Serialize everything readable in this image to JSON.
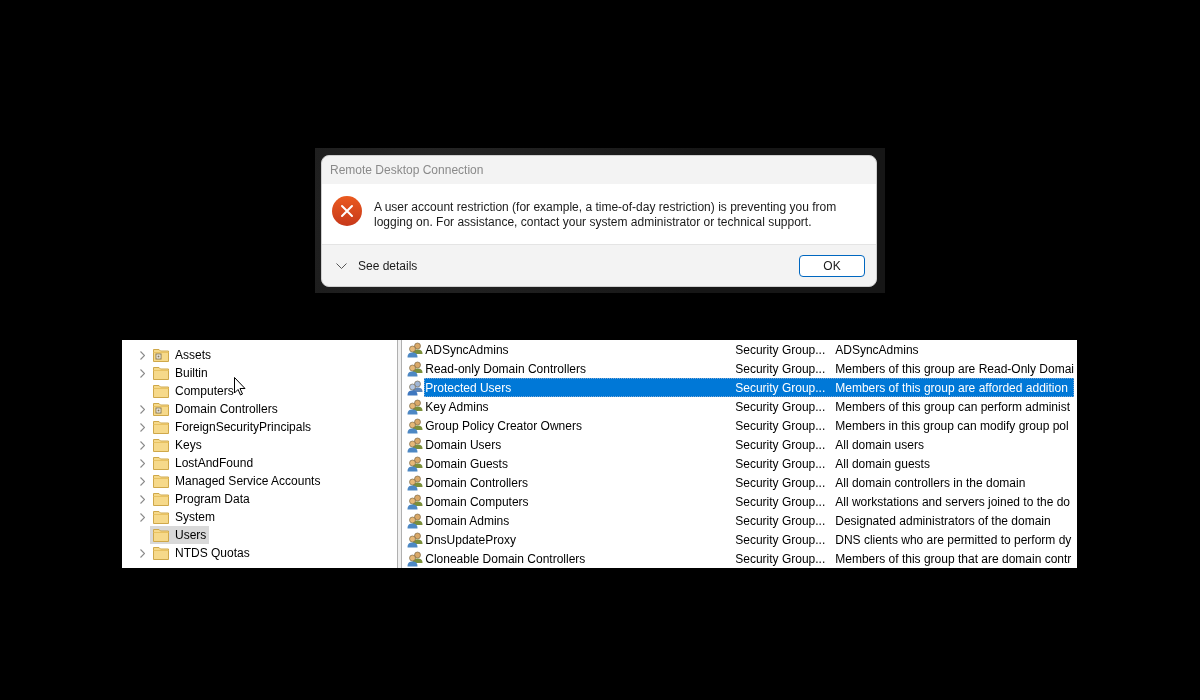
{
  "dialog": {
    "title": "Remote Desktop Connection",
    "message": "A user account restriction (for example, a time-of-day restriction) is preventing you from logging on. For assistance, contact your system administrator or technical support.",
    "details_label": "See details",
    "button": "OK"
  },
  "tree": {
    "items": [
      {
        "label": "Assets",
        "kind": "ou",
        "expandable": true,
        "selected": false
      },
      {
        "label": "Builtin",
        "kind": "folder",
        "expandable": true,
        "selected": false
      },
      {
        "label": "Computers",
        "kind": "folder",
        "expandable": false,
        "selected": false
      },
      {
        "label": "Domain Controllers",
        "kind": "ou",
        "expandable": true,
        "selected": false
      },
      {
        "label": "ForeignSecurityPrincipals",
        "kind": "folder",
        "expandable": true,
        "selected": false
      },
      {
        "label": "Keys",
        "kind": "folder",
        "expandable": true,
        "selected": false
      },
      {
        "label": "LostAndFound",
        "kind": "folder",
        "expandable": true,
        "selected": false
      },
      {
        "label": "Managed Service Accounts",
        "kind": "folder",
        "expandable": true,
        "selected": false
      },
      {
        "label": "Program Data",
        "kind": "folder",
        "expandable": true,
        "selected": false
      },
      {
        "label": "System",
        "kind": "folder",
        "expandable": true,
        "selected": false
      },
      {
        "label": "Users",
        "kind": "folder",
        "expandable": false,
        "selected": true
      },
      {
        "label": "NTDS Quotas",
        "kind": "folder",
        "expandable": true,
        "selected": false
      }
    ]
  },
  "list": {
    "rows": [
      {
        "name": "ADSyncAdmins",
        "type": "Security Group...",
        "description": "ADSyncAdmins",
        "selected": false
      },
      {
        "name": "Read-only Domain Controllers",
        "type": "Security Group...",
        "description": "Members of this group are Read-Only Domai",
        "selected": false
      },
      {
        "name": "Protected Users",
        "type": "Security Group...",
        "description": "Members of this group are afforded addition",
        "selected": true
      },
      {
        "name": "Key Admins",
        "type": "Security Group...",
        "description": "Members of this group can perform administ",
        "selected": false
      },
      {
        "name": "Group Policy Creator Owners",
        "type": "Security Group...",
        "description": "Members in this group can modify group pol",
        "selected": false
      },
      {
        "name": "Domain Users",
        "type": "Security Group...",
        "description": "All domain users",
        "selected": false
      },
      {
        "name": "Domain Guests",
        "type": "Security Group...",
        "description": "All domain guests",
        "selected": false
      },
      {
        "name": "Domain Controllers",
        "type": "Security Group...",
        "description": "All domain controllers in the domain",
        "selected": false
      },
      {
        "name": "Domain Computers",
        "type": "Security Group...",
        "description": "All workstations and servers joined to the do",
        "selected": false
      },
      {
        "name": "Domain Admins",
        "type": "Security Group...",
        "description": "Designated administrators of the domain",
        "selected": false
      },
      {
        "name": "DnsUpdateProxy",
        "type": "Security Group...",
        "description": "DNS clients who are permitted to perform dy",
        "selected": false
      },
      {
        "name": "Cloneable Domain Controllers",
        "type": "Security Group...",
        "description": "Members of this group that are domain contr",
        "selected": false
      }
    ]
  }
}
